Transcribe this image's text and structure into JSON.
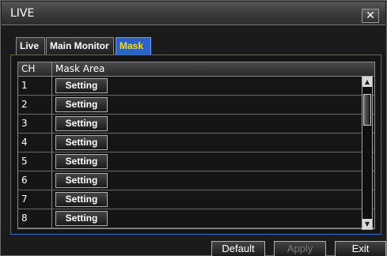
{
  "window": {
    "title": "LIVE",
    "close_glyph": "✕"
  },
  "tabs": [
    {
      "label": "Live",
      "active": false
    },
    {
      "label": "Main Monitor",
      "active": false
    },
    {
      "label": "Mask",
      "active": true
    }
  ],
  "table": {
    "columns": [
      "CH",
      "Mask Area"
    ],
    "rows": [
      {
        "ch": "1",
        "action": "Setting"
      },
      {
        "ch": "2",
        "action": "Setting"
      },
      {
        "ch": "3",
        "action": "Setting"
      },
      {
        "ch": "4",
        "action": "Setting"
      },
      {
        "ch": "5",
        "action": "Setting"
      },
      {
        "ch": "6",
        "action": "Setting"
      },
      {
        "ch": "7",
        "action": "Setting"
      },
      {
        "ch": "8",
        "action": "Setting"
      }
    ]
  },
  "scrollbar": {
    "up_icon": "scroll-up-arrow",
    "down_icon": "scroll-down-arrow"
  },
  "footer": {
    "default_label": "Default",
    "apply_label": "Apply",
    "exit_label": "Exit",
    "apply_enabled": false
  },
  "colors": {
    "accent": "#2d63c8",
    "active_tab_text": "#ffd800"
  }
}
